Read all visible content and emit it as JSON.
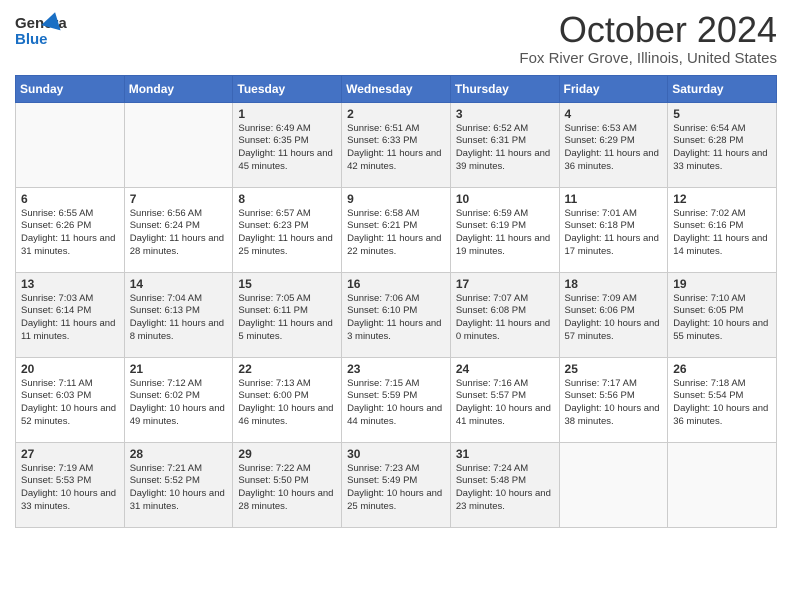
{
  "header": {
    "logo_line1": "General",
    "logo_line2": "Blue",
    "month": "October 2024",
    "location": "Fox River Grove, Illinois, United States"
  },
  "weekdays": [
    "Sunday",
    "Monday",
    "Tuesday",
    "Wednesday",
    "Thursday",
    "Friday",
    "Saturday"
  ],
  "weeks": [
    [
      {
        "day": "",
        "info": ""
      },
      {
        "day": "",
        "info": ""
      },
      {
        "day": "1",
        "info": "Sunrise: 6:49 AM\nSunset: 6:35 PM\nDaylight: 11 hours and 45 minutes."
      },
      {
        "day": "2",
        "info": "Sunrise: 6:51 AM\nSunset: 6:33 PM\nDaylight: 11 hours and 42 minutes."
      },
      {
        "day": "3",
        "info": "Sunrise: 6:52 AM\nSunset: 6:31 PM\nDaylight: 11 hours and 39 minutes."
      },
      {
        "day": "4",
        "info": "Sunrise: 6:53 AM\nSunset: 6:29 PM\nDaylight: 11 hours and 36 minutes."
      },
      {
        "day": "5",
        "info": "Sunrise: 6:54 AM\nSunset: 6:28 PM\nDaylight: 11 hours and 33 minutes."
      }
    ],
    [
      {
        "day": "6",
        "info": "Sunrise: 6:55 AM\nSunset: 6:26 PM\nDaylight: 11 hours and 31 minutes."
      },
      {
        "day": "7",
        "info": "Sunrise: 6:56 AM\nSunset: 6:24 PM\nDaylight: 11 hours and 28 minutes."
      },
      {
        "day": "8",
        "info": "Sunrise: 6:57 AM\nSunset: 6:23 PM\nDaylight: 11 hours and 25 minutes."
      },
      {
        "day": "9",
        "info": "Sunrise: 6:58 AM\nSunset: 6:21 PM\nDaylight: 11 hours and 22 minutes."
      },
      {
        "day": "10",
        "info": "Sunrise: 6:59 AM\nSunset: 6:19 PM\nDaylight: 11 hours and 19 minutes."
      },
      {
        "day": "11",
        "info": "Sunrise: 7:01 AM\nSunset: 6:18 PM\nDaylight: 11 hours and 17 minutes."
      },
      {
        "day": "12",
        "info": "Sunrise: 7:02 AM\nSunset: 6:16 PM\nDaylight: 11 hours and 14 minutes."
      }
    ],
    [
      {
        "day": "13",
        "info": "Sunrise: 7:03 AM\nSunset: 6:14 PM\nDaylight: 11 hours and 11 minutes."
      },
      {
        "day": "14",
        "info": "Sunrise: 7:04 AM\nSunset: 6:13 PM\nDaylight: 11 hours and 8 minutes."
      },
      {
        "day": "15",
        "info": "Sunrise: 7:05 AM\nSunset: 6:11 PM\nDaylight: 11 hours and 5 minutes."
      },
      {
        "day": "16",
        "info": "Sunrise: 7:06 AM\nSunset: 6:10 PM\nDaylight: 11 hours and 3 minutes."
      },
      {
        "day": "17",
        "info": "Sunrise: 7:07 AM\nSunset: 6:08 PM\nDaylight: 11 hours and 0 minutes."
      },
      {
        "day": "18",
        "info": "Sunrise: 7:09 AM\nSunset: 6:06 PM\nDaylight: 10 hours and 57 minutes."
      },
      {
        "day": "19",
        "info": "Sunrise: 7:10 AM\nSunset: 6:05 PM\nDaylight: 10 hours and 55 minutes."
      }
    ],
    [
      {
        "day": "20",
        "info": "Sunrise: 7:11 AM\nSunset: 6:03 PM\nDaylight: 10 hours and 52 minutes."
      },
      {
        "day": "21",
        "info": "Sunrise: 7:12 AM\nSunset: 6:02 PM\nDaylight: 10 hours and 49 minutes."
      },
      {
        "day": "22",
        "info": "Sunrise: 7:13 AM\nSunset: 6:00 PM\nDaylight: 10 hours and 46 minutes."
      },
      {
        "day": "23",
        "info": "Sunrise: 7:15 AM\nSunset: 5:59 PM\nDaylight: 10 hours and 44 minutes."
      },
      {
        "day": "24",
        "info": "Sunrise: 7:16 AM\nSunset: 5:57 PM\nDaylight: 10 hours and 41 minutes."
      },
      {
        "day": "25",
        "info": "Sunrise: 7:17 AM\nSunset: 5:56 PM\nDaylight: 10 hours and 38 minutes."
      },
      {
        "day": "26",
        "info": "Sunrise: 7:18 AM\nSunset: 5:54 PM\nDaylight: 10 hours and 36 minutes."
      }
    ],
    [
      {
        "day": "27",
        "info": "Sunrise: 7:19 AM\nSunset: 5:53 PM\nDaylight: 10 hours and 33 minutes."
      },
      {
        "day": "28",
        "info": "Sunrise: 7:21 AM\nSunset: 5:52 PM\nDaylight: 10 hours and 31 minutes."
      },
      {
        "day": "29",
        "info": "Sunrise: 7:22 AM\nSunset: 5:50 PM\nDaylight: 10 hours and 28 minutes."
      },
      {
        "day": "30",
        "info": "Sunrise: 7:23 AM\nSunset: 5:49 PM\nDaylight: 10 hours and 25 minutes."
      },
      {
        "day": "31",
        "info": "Sunrise: 7:24 AM\nSunset: 5:48 PM\nDaylight: 10 hours and 23 minutes."
      },
      {
        "day": "",
        "info": ""
      },
      {
        "day": "",
        "info": ""
      }
    ]
  ]
}
